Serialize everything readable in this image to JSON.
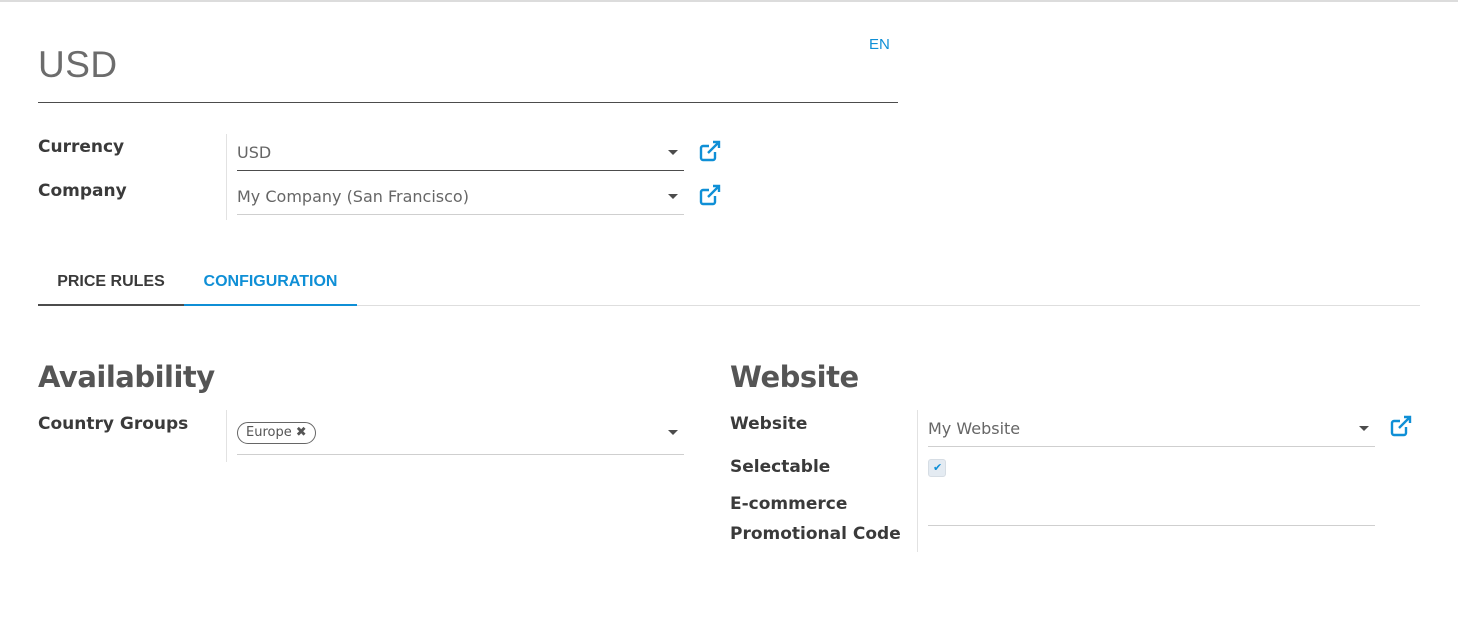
{
  "record": {
    "title": "USD",
    "lang_button": "EN"
  },
  "fields": {
    "currency": {
      "label": "Currency",
      "value": "USD"
    },
    "company": {
      "label": "Company",
      "value": "My Company (San Francisco)"
    }
  },
  "tabs": [
    {
      "label": "PRICE RULES",
      "active": false
    },
    {
      "label": "CONFIGURATION",
      "active": true
    }
  ],
  "availability": {
    "title": "Availability",
    "country_groups_label": "Country Groups",
    "country_groups_tags": [
      {
        "label": "Europe",
        "remove_icon": "x-icon"
      }
    ]
  },
  "website_section": {
    "title": "Website",
    "website_label": "Website",
    "website_value": "My Website",
    "selectable_label": "Selectable",
    "selectable_checked": true,
    "promo_label_line1": "E-commerce",
    "promo_label_line2": "Promotional Code",
    "promo_value": ""
  },
  "colors": {
    "accent": "#0f8fd6",
    "text": "#4c4c4c"
  }
}
